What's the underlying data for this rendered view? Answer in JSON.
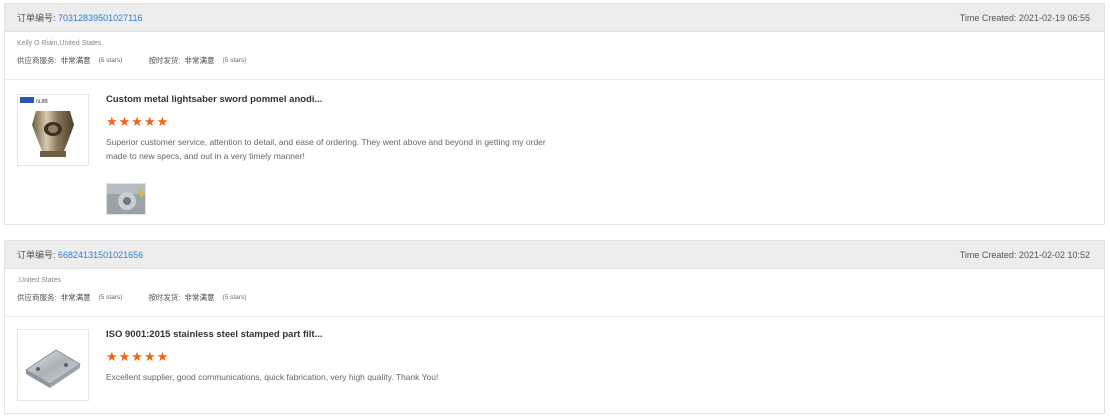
{
  "reviews": [
    {
      "order_label": "订单编号:",
      "order_id": "70312839501027116",
      "time_created": "Time Created: 2021-02-19 06:55",
      "buyer": "Kelly O Riain,United States",
      "ratings": {
        "supplier_label": "供应商服务:",
        "supplier_value": "非常满意",
        "supplier_stars": "(5 stars)",
        "delivery_label": "按时发货:",
        "delivery_value": "非常满意",
        "delivery_stars": "(5 stars)"
      },
      "product_title": "Custom metal lightsaber sword pommel anodi...",
      "stars": "★★★★★",
      "rating": 5,
      "review_text": "Superior customer service, attention to detail, and ease of ordering. They went above and beyond in getting my order made to new specs, and out in a very timely manner!",
      "thumb_icon": "metal-pommel-image",
      "photo_icon": "review-photo-image"
    },
    {
      "order_label": "订单编号:",
      "order_id": "66824131501021656",
      "time_created": "Time Created: 2021-02-02 10:52",
      "buyer": ",United States",
      "ratings": {
        "supplier_label": "供应商服务:",
        "supplier_value": "非常满意",
        "supplier_stars": "(5 stars)",
        "delivery_label": "按时发货:",
        "delivery_value": "非常满意",
        "delivery_stars": "(5 stars)"
      },
      "product_title": "ISO 9001:2015 stainless steel stamped part filt...",
      "stars": "★★★★★",
      "rating": 5,
      "review_text": "Excellent supplier, good communications, quick fabrication, very high quality.  Thank You!",
      "thumb_icon": "stamped-part-image"
    }
  ],
  "colors": {
    "link": "#2f7fd0",
    "star": "#f4620a",
    "header_bg": "#ededed"
  }
}
